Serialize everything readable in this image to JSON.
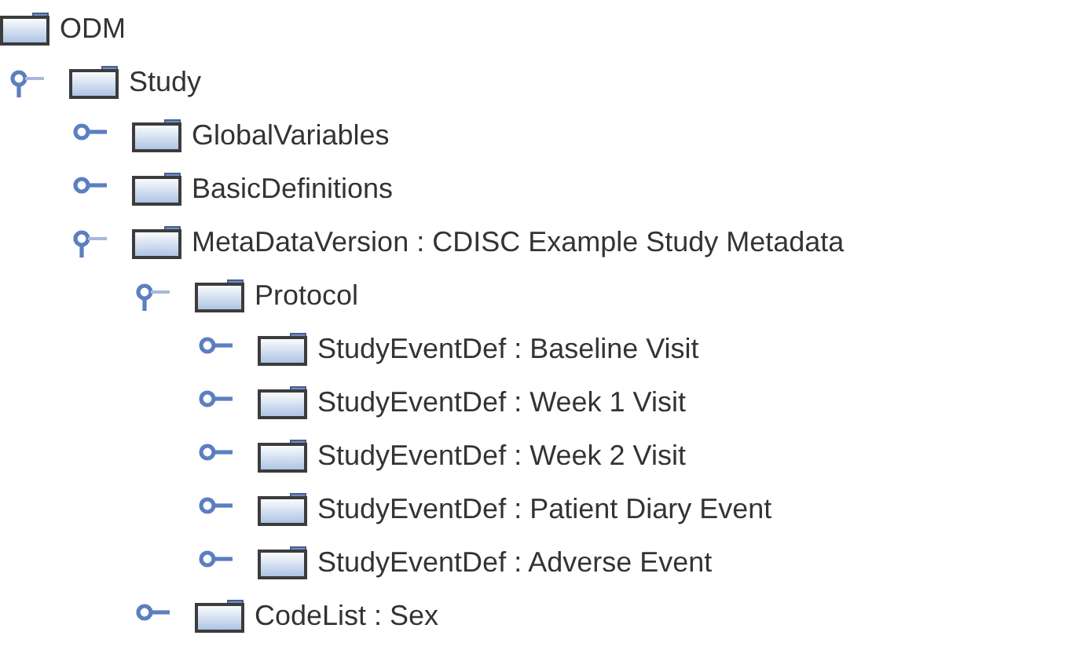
{
  "tree": [
    {
      "label": "ODM",
      "children": [
        {
          "label": "Study",
          "expanded": true,
          "children": [
            {
              "label": "GlobalVariables",
              "expanded": false
            },
            {
              "label": "BasicDefinitions",
              "expanded": false
            },
            {
              "label": "MetaDataVersion : CDISC Example Study Metadata",
              "expanded": true,
              "children": [
                {
                  "label": "Protocol",
                  "expanded": true,
                  "children": [
                    {
                      "label": "StudyEventDef : Baseline Visit",
                      "expanded": false
                    },
                    {
                      "label": "StudyEventDef : Week 1 Visit",
                      "expanded": false
                    },
                    {
                      "label": "StudyEventDef : Week 2 Visit",
                      "expanded": false
                    },
                    {
                      "label": "StudyEventDef : Patient Diary Event",
                      "expanded": false
                    },
                    {
                      "label": "StudyEventDef : Adverse Event",
                      "expanded": false
                    }
                  ]
                },
                {
                  "label": "CodeList : Sex",
                  "expanded": false
                }
              ]
            }
          ]
        }
      ]
    }
  ]
}
